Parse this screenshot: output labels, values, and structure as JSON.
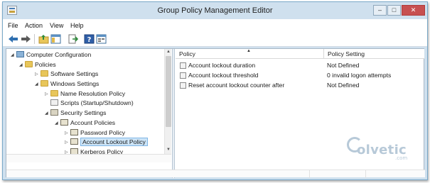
{
  "window": {
    "title": "Group Policy Management Editor"
  },
  "menubar": {
    "items": [
      "File",
      "Action",
      "View",
      "Help"
    ]
  },
  "toolbar": {
    "buttons": [
      "back-arrow-icon",
      "forward-arrow-icon",
      "up-folder-icon",
      "show-hide-tree-icon",
      "export-list-icon",
      "help-icon",
      "properties-icon"
    ]
  },
  "tree": {
    "items": [
      {
        "label": "Computer Configuration",
        "icon": "computer-icon",
        "expander": "expanded"
      },
      {
        "label": "Policies",
        "icon": "folder-icon",
        "expander": "expanded"
      },
      {
        "label": "Software Settings",
        "icon": "folder-icon",
        "expander": "collapsed"
      },
      {
        "label": "Windows Settings",
        "icon": "folder-icon",
        "expander": "expanded"
      },
      {
        "label": "Name Resolution Policy",
        "icon": "folder-icon",
        "expander": "collapsed"
      },
      {
        "label": "Scripts (Startup/Shutdown)",
        "icon": "script-icon",
        "expander": "none"
      },
      {
        "label": "Security Settings",
        "icon": "security-icon",
        "expander": "expanded"
      },
      {
        "label": "Account Policies",
        "icon": "policy-folder-icon",
        "expander": "expanded"
      },
      {
        "label": "Password Policy",
        "icon": "policy-folder-icon",
        "expander": "collapsed"
      },
      {
        "label": "Account Lockout Policy",
        "icon": "policy-folder-icon",
        "expander": "collapsed",
        "selected": true
      },
      {
        "label": "Kerberos Policy",
        "icon": "policy-folder-icon",
        "expander": "collapsed"
      }
    ]
  },
  "list": {
    "columns": [
      "Policy",
      "Policy Setting"
    ],
    "rows": [
      {
        "policy": "Account lockout duration",
        "setting": "Not Defined"
      },
      {
        "policy": "Account lockout threshold",
        "setting": "0 invalid logon attempts"
      },
      {
        "policy": "Reset account lockout counter after",
        "setting": "Not Defined"
      }
    ]
  },
  "watermark": {
    "text": "olvetic",
    "suffix": ".com"
  }
}
